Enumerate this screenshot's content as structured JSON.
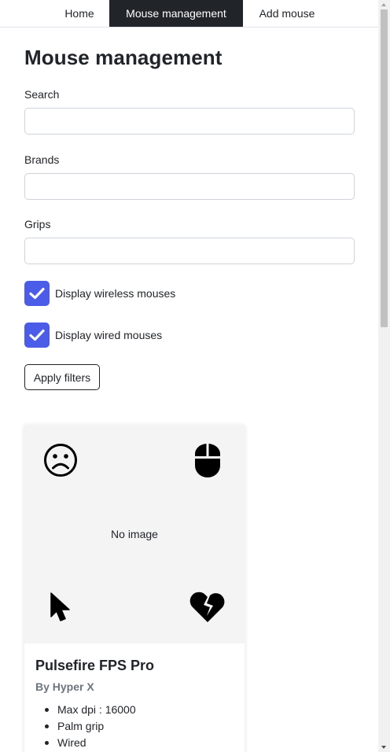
{
  "nav": {
    "items": [
      {
        "label": "Home"
      },
      {
        "label": "Mouse management",
        "active": true
      },
      {
        "label": "Add mouse"
      }
    ]
  },
  "page": {
    "title": "Mouse management"
  },
  "filters": {
    "search": {
      "label": "Search",
      "value": "",
      "placeholder": ""
    },
    "brands": {
      "label": "Brands",
      "value": "",
      "placeholder": ""
    },
    "grips": {
      "label": "Grips",
      "value": "",
      "placeholder": ""
    },
    "wireless": {
      "label": "Display wireless mouses",
      "checked": true
    },
    "wired": {
      "label": "Display wired mouses",
      "checked": true
    },
    "apply_label": "Apply filters"
  },
  "colors": {
    "accent": "#4a5ce8",
    "nav_active": "#212529",
    "muted": "#6c757d"
  },
  "cards": [
    {
      "no_image_text": "No image",
      "icons": [
        "sad-face-icon",
        "mouse-icon",
        "cursor-arrow-icon",
        "broken-heart-icon"
      ],
      "title": "Pulsefire FPS Pro",
      "brand": "By Hyper X",
      "specs": [
        "Max dpi : 16000",
        "Palm grip",
        "Wired"
      ]
    }
  ]
}
